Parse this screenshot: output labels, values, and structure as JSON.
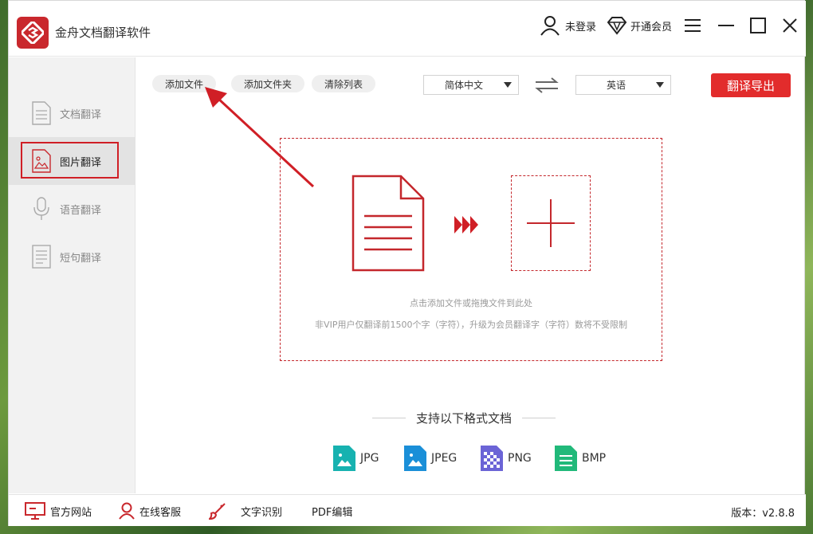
{
  "app": {
    "title": "金舟文档翻译软件"
  },
  "header": {
    "login_label": "未登录",
    "vip_label": "开通会员"
  },
  "sidebar": {
    "items": [
      {
        "label": "文档翻译",
        "icon": "document-icon",
        "active": false
      },
      {
        "label": "图片翻译",
        "icon": "image-icon",
        "active": true
      },
      {
        "label": "语音翻译",
        "icon": "microphone-icon",
        "active": false
      },
      {
        "label": "短句翻译",
        "icon": "sentence-icon",
        "active": false
      }
    ]
  },
  "toolbar": {
    "add_file": "添加文件",
    "add_folder": "添加文件夹",
    "clear_list": "清除列表",
    "source_language": "简体中文",
    "target_language": "英语",
    "export_label": "翻译导出"
  },
  "dropzone": {
    "hint": "点击添加文件或拖拽文件到此处",
    "limit_note": "非VIP用户仅翻译前1500个字（字符），升级为会员翻译字（字符）数将不受限制"
  },
  "formats": {
    "title": "支持以下格式文档",
    "items": [
      {
        "label": "JPG",
        "color": "#17b2b0"
      },
      {
        "label": "JPEG",
        "color": "#1a8fd8"
      },
      {
        "label": "PNG",
        "color": "#6b64d6"
      },
      {
        "label": "BMP",
        "color": "#21b97a"
      }
    ]
  },
  "statusbar": {
    "website": "官方网站",
    "support": "在线客服",
    "ocr": "文字识别",
    "pdf_edit": "PDF编辑",
    "version": "版本：v2.8.8"
  },
  "colors": {
    "accent": "#d01f26",
    "export_button": "#e22c2c"
  }
}
